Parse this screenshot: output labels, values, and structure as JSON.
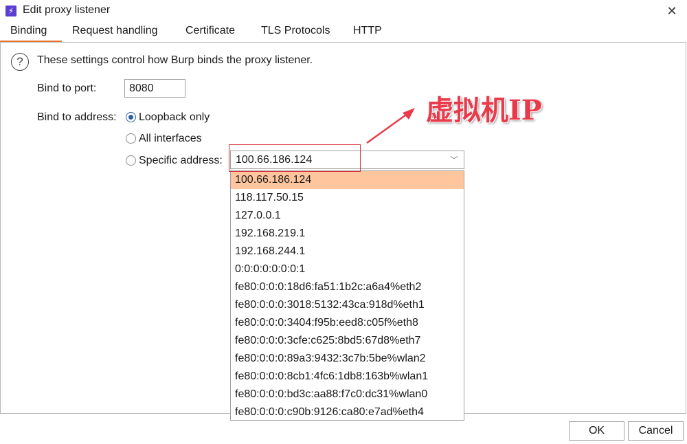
{
  "window": {
    "title": "Edit proxy listener"
  },
  "tabs": [
    "Binding",
    "Request handling",
    "Certificate",
    "TLS Protocols",
    "HTTP"
  ],
  "binding": {
    "description": "These settings control how Burp binds the proxy listener.",
    "port_label": "Bind to port:",
    "port_value": "8080",
    "address_label": "Bind to address:",
    "options": [
      "Loopback only",
      "All interfaces",
      "Specific address:"
    ],
    "selected_option": "Loopback only",
    "specific_address_value": "100.66.186.124",
    "address_list": [
      "100.66.186.124",
      "118.117.50.15",
      "127.0.0.1",
      "192.168.219.1",
      "192.168.244.1",
      "0:0:0:0:0:0:0:1",
      "fe80:0:0:0:18d6:fa51:1b2c:a6a4%eth2",
      "fe80:0:0:0:3018:5132:43ca:918d%eth1",
      "fe80:0:0:0:3404:f95b:eed8:c05f%eth8",
      "fe80:0:0:0:3cfe:c625:8bd5:67d8%eth7",
      "fe80:0:0:0:89a3:9432:3c7b:5be%wlan2",
      "fe80:0:0:0:8cb1:4fc6:1db8:163b%wlan1",
      "fe80:0:0:0:bd3c:aa88:f7c0:dc31%wlan0",
      "fe80:0:0:0:c90b:9126:ca80:e7ad%eth4"
    ]
  },
  "annotation": {
    "text": "虚拟机IP",
    "color": "#e83a4a"
  },
  "buttons": {
    "ok": "OK",
    "cancel": "Cancel"
  },
  "colors": {
    "accent_tab": "#e8742c",
    "selected_row": "#ffc59c",
    "radio": "#2b5fa8"
  }
}
